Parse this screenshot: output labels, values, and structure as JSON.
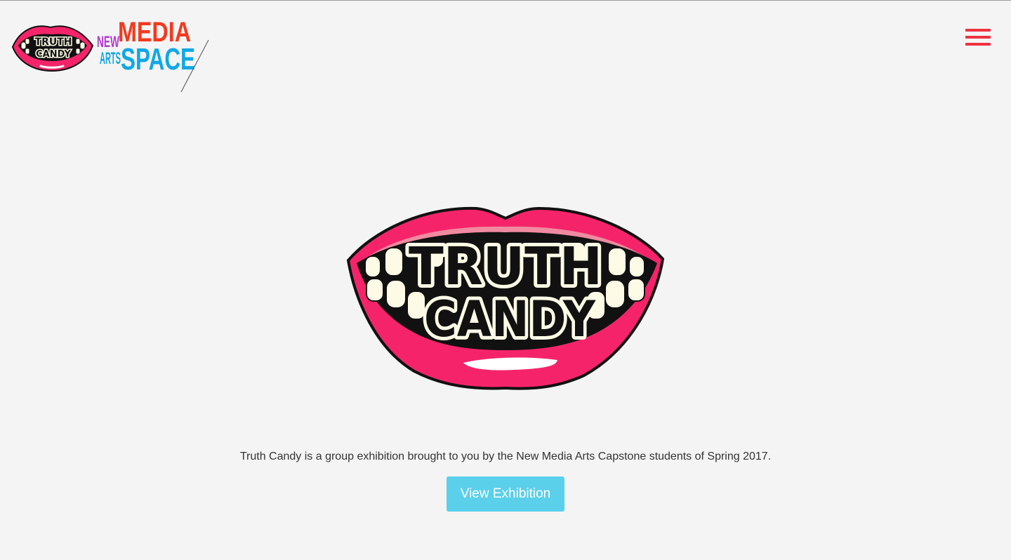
{
  "header": {
    "logo_main_text": "TRUTH CANDY",
    "brand_line1_a": "NEW",
    "brand_line1_b": "MEDIA",
    "brand_line2_a": "ARTS",
    "brand_line2_b": "SPACE",
    "menu_icon": "hamburger-menu-icon"
  },
  "hero": {
    "logo_line1": "TRUTH",
    "logo_line2": "CANDY"
  },
  "main": {
    "description": "Truth Candy is a group exhibition brought to you by the New Media Arts Capstone students of Spring 2017.",
    "cta_label": "View Exhibition"
  },
  "colors": {
    "background": "#f4f4f4",
    "accent_red": "#ee3342",
    "lips_pink": "#f5246a",
    "button_cyan": "#5bd0ea",
    "brand_purple": "#b03ccf",
    "brand_orange": "#f23a1f",
    "brand_blue": "#11a7e6"
  }
}
